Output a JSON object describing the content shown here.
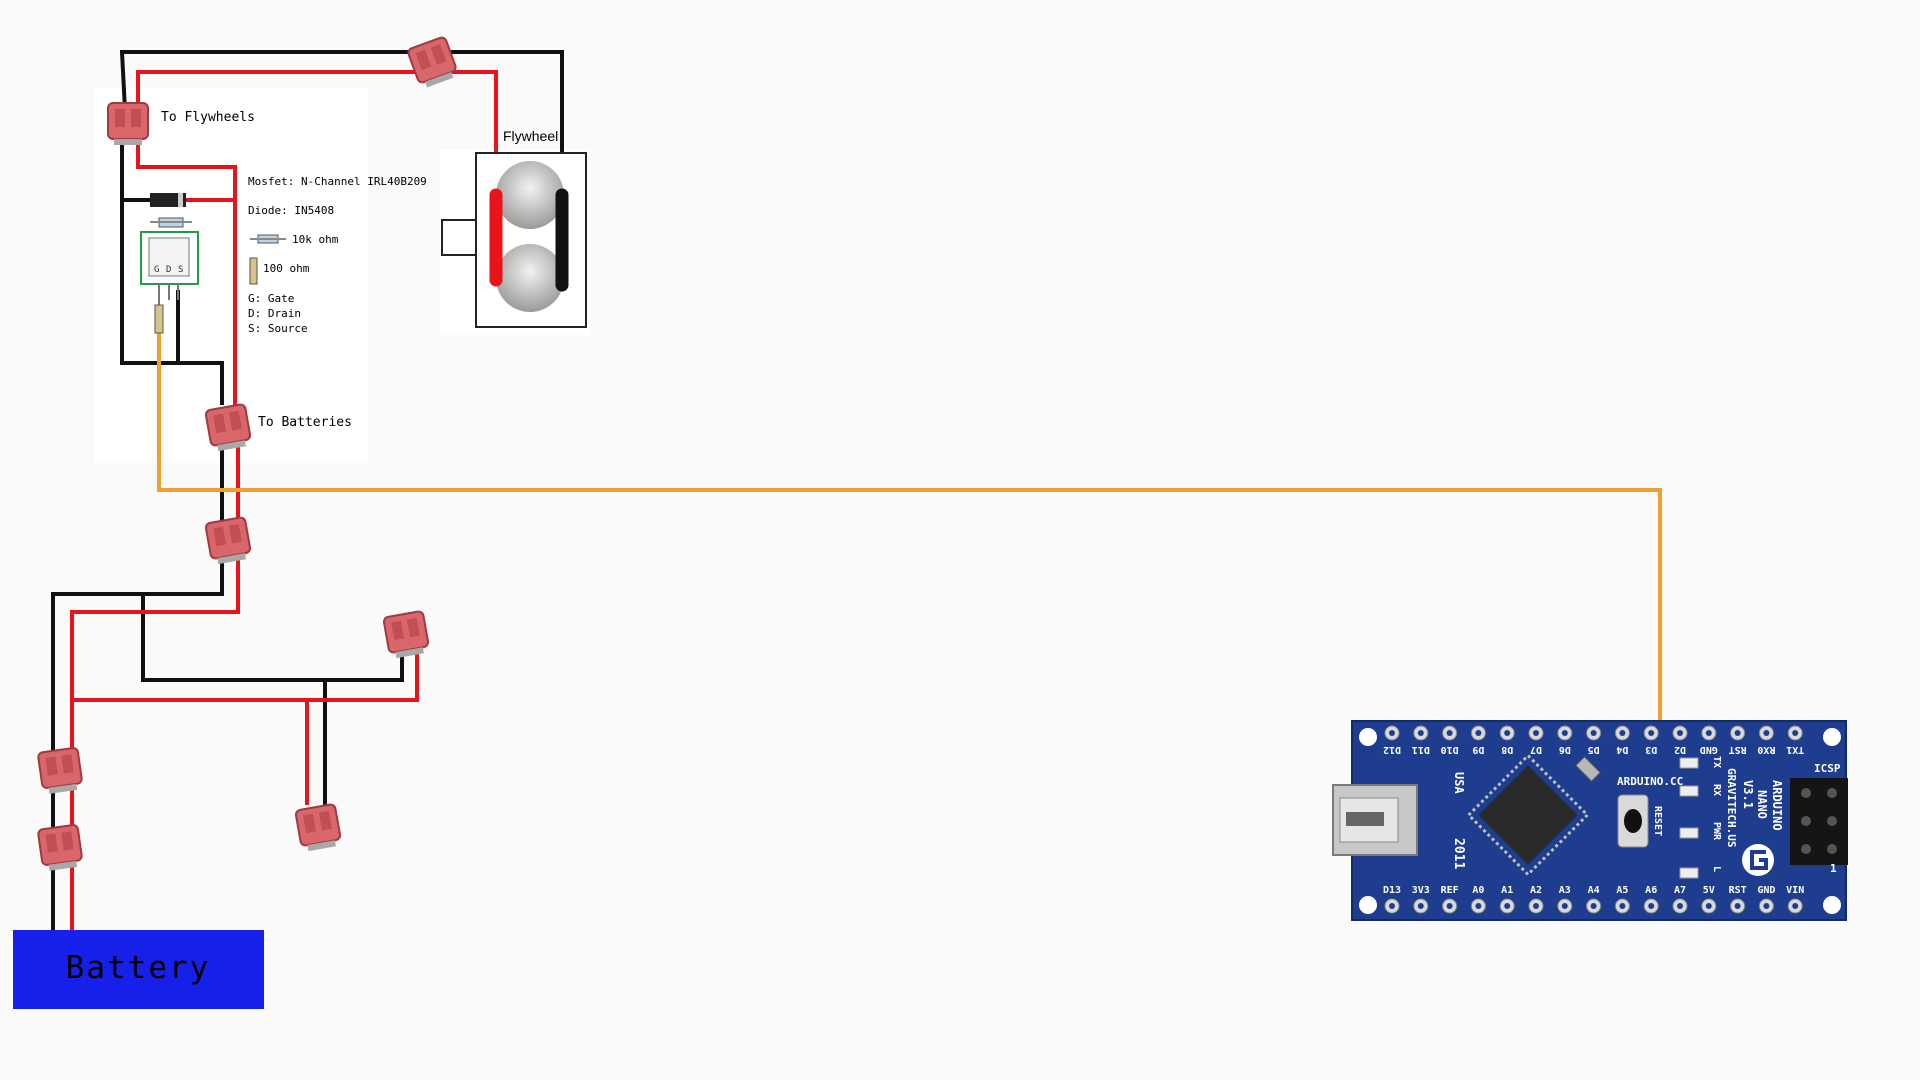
{
  "labels": {
    "to_flywheels": "To Flywheels",
    "to_batteries": "To Batteries",
    "flywheel": "Flywheel",
    "battery": "Battery"
  },
  "legend": {
    "mosfet": "Mosfet: N-Channel IRL40B209",
    "diode": "Diode: IN5408",
    "r10k": "10k ohm",
    "r100": "100 ohm",
    "gate": "G: Gate",
    "drain": "D: Drain",
    "source": "S: Source"
  },
  "mosfet_pins": {
    "g": "G",
    "d": "D",
    "s": "S"
  },
  "arduino": {
    "top_pins": [
      "D12",
      "D11",
      "D10",
      "D9",
      "D8",
      "D7",
      "D6",
      "D5",
      "D4",
      "D3",
      "D2",
      "GND",
      "RST",
      "RX0",
      "TX1"
    ],
    "bottom_pins": [
      "D13",
      "3V3",
      "REF",
      "A0",
      "A1",
      "A2",
      "A3",
      "A4",
      "A5",
      "A6",
      "A7",
      "5V",
      "RST",
      "GND",
      "VIN"
    ],
    "brand": "ARDUINO.CC",
    "model_1": "ARDUINO",
    "model_2": "NANO",
    "model_3": "V3.1",
    "maker": "GRAVITECH.US",
    "usa": "USA",
    "year": "2011",
    "tx": "TX",
    "rx": "RX",
    "pwr": "PWR",
    "l": "L",
    "reset": "RESET",
    "icsp": "ICSP",
    "one": "1"
  },
  "colors": {
    "wire_red": "#e8141b",
    "wire_black": "#111111",
    "signal_orange": "#f0a030",
    "battery_blue": "#1620e8",
    "connector_red": "#d9666a",
    "board_blue": "#1e3d8f",
    "mosfet_outline": "#1ea040"
  }
}
